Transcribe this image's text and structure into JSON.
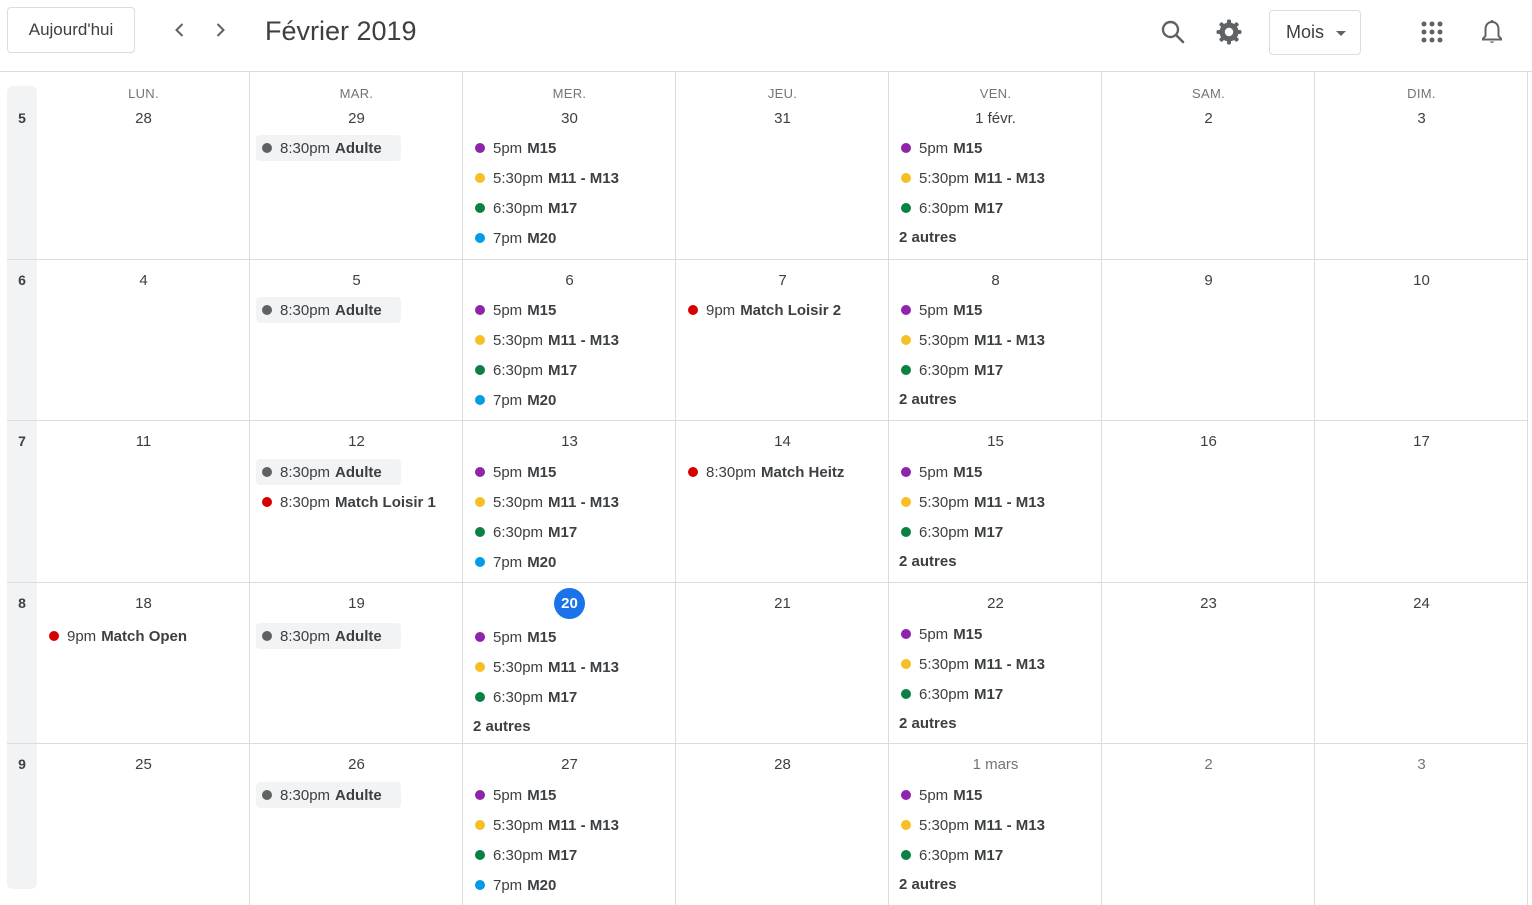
{
  "header": {
    "today_label": "Aujourd'hui",
    "title": "Février 2019",
    "view_label": "Mois",
    "icons": [
      "chevron-left-icon",
      "chevron-right-icon",
      "search-icon",
      "gear-icon",
      "apps-grid-icon",
      "bell-icon"
    ]
  },
  "colors": {
    "purple": "#8e24aa",
    "yellow": "#f6bf26",
    "green": "#0b8043",
    "blue": "#039be5",
    "red": "#d50000",
    "grey": "#616161",
    "today": "#1a73e8"
  },
  "day_names": [
    "LUN.",
    "MAR.",
    "MER.",
    "JEU.",
    "VEN.",
    "SAM.",
    "DIM."
  ],
  "week_numbers": [
    "5",
    "6",
    "7",
    "8",
    "9"
  ],
  "weeks": [
    {
      "dates": [
        "28",
        "29",
        "30",
        "31",
        "1 févr.",
        "2",
        "3"
      ]
    },
    {
      "dates": [
        "4",
        "5",
        "6",
        "7",
        "8",
        "9",
        "10"
      ]
    },
    {
      "dates": [
        "11",
        "12",
        "13",
        "14",
        "15",
        "16",
        "17"
      ]
    },
    {
      "dates": [
        "18",
        "19",
        "20",
        "21",
        "22",
        "23",
        "24"
      ]
    },
    {
      "dates": [
        "25",
        "26",
        "27",
        "28",
        "1 mars",
        "2",
        "3"
      ]
    }
  ],
  "today_date": "20",
  "events": {
    "w0": {
      "tue": [
        {
          "time": "8:30pm",
          "title": "Adulte",
          "color": "grey"
        }
      ],
      "wed": [
        {
          "time": "5pm",
          "title": "M15",
          "color": "purple"
        },
        {
          "time": "5:30pm",
          "title": "M11 - M13",
          "color": "yellow"
        },
        {
          "time": "6:30pm",
          "title": "M17",
          "color": "green"
        },
        {
          "time": "7pm",
          "title": "M20",
          "color": "blue"
        }
      ],
      "fri": [
        {
          "time": "5pm",
          "title": "M15",
          "color": "purple"
        },
        {
          "time": "5:30pm",
          "title": "M11 - M13",
          "color": "yellow"
        },
        {
          "time": "6:30pm",
          "title": "M17",
          "color": "green"
        }
      ],
      "fri_more": "2 autres"
    },
    "w1": {
      "tue": [
        {
          "time": "8:30pm",
          "title": "Adulte",
          "color": "grey"
        }
      ],
      "wed": [
        {
          "time": "5pm",
          "title": "M15",
          "color": "purple"
        },
        {
          "time": "5:30pm",
          "title": "M11 - M13",
          "color": "yellow"
        },
        {
          "time": "6:30pm",
          "title": "M17",
          "color": "green"
        },
        {
          "time": "7pm",
          "title": "M20",
          "color": "blue"
        }
      ],
      "thu": [
        {
          "time": "9pm",
          "title": "Match Loisir 2",
          "color": "red"
        }
      ],
      "fri": [
        {
          "time": "5pm",
          "title": "M15",
          "color": "purple"
        },
        {
          "time": "5:30pm",
          "title": "M11 - M13",
          "color": "yellow"
        },
        {
          "time": "6:30pm",
          "title": "M17",
          "color": "green"
        }
      ],
      "fri_more": "2 autres"
    },
    "w2": {
      "tue": [
        {
          "time": "8:30pm",
          "title": "Adulte",
          "color": "grey"
        },
        {
          "time": "8:30pm",
          "title": "Match Loisir 1",
          "color": "red"
        }
      ],
      "wed": [
        {
          "time": "5pm",
          "title": "M15",
          "color": "purple"
        },
        {
          "time": "5:30pm",
          "title": "M11 - M13",
          "color": "yellow"
        },
        {
          "time": "6:30pm",
          "title": "M17",
          "color": "green"
        },
        {
          "time": "7pm",
          "title": "M20",
          "color": "blue"
        }
      ],
      "thu": [
        {
          "time": "8:30pm",
          "title": "Match Heitz",
          "color": "red"
        }
      ],
      "fri": [
        {
          "time": "5pm",
          "title": "M15",
          "color": "purple"
        },
        {
          "time": "5:30pm",
          "title": "M11 - M13",
          "color": "yellow"
        },
        {
          "time": "6:30pm",
          "title": "M17",
          "color": "green"
        }
      ],
      "fri_more": "2 autres"
    },
    "w3": {
      "mon": [
        {
          "time": "9pm",
          "title": "Match Open",
          "color": "red"
        }
      ],
      "tue": [
        {
          "time": "8:30pm",
          "title": "Adulte",
          "color": "grey"
        }
      ],
      "wed": [
        {
          "time": "5pm",
          "title": "M15",
          "color": "purple"
        },
        {
          "time": "5:30pm",
          "title": "M11 - M13",
          "color": "yellow"
        },
        {
          "time": "6:30pm",
          "title": "M17",
          "color": "green"
        }
      ],
      "wed_more": "2 autres",
      "fri": [
        {
          "time": "5pm",
          "title": "M15",
          "color": "purple"
        },
        {
          "time": "5:30pm",
          "title": "M11 - M13",
          "color": "yellow"
        },
        {
          "time": "6:30pm",
          "title": "M17",
          "color": "green"
        }
      ],
      "fri_more": "2 autres"
    },
    "w4": {
      "tue": [
        {
          "time": "8:30pm",
          "title": "Adulte",
          "color": "grey"
        }
      ],
      "wed": [
        {
          "time": "5pm",
          "title": "M15",
          "color": "purple"
        },
        {
          "time": "5:30pm",
          "title": "M11 - M13",
          "color": "yellow"
        },
        {
          "time": "6:30pm",
          "title": "M17",
          "color": "green"
        },
        {
          "time": "7pm",
          "title": "M20",
          "color": "blue"
        }
      ],
      "fri": [
        {
          "time": "5pm",
          "title": "M15",
          "color": "purple"
        },
        {
          "time": "5:30pm",
          "title": "M11 - M13",
          "color": "yellow"
        },
        {
          "time": "6:30pm",
          "title": "M17",
          "color": "green"
        }
      ],
      "fri_more": "2 autres"
    }
  }
}
